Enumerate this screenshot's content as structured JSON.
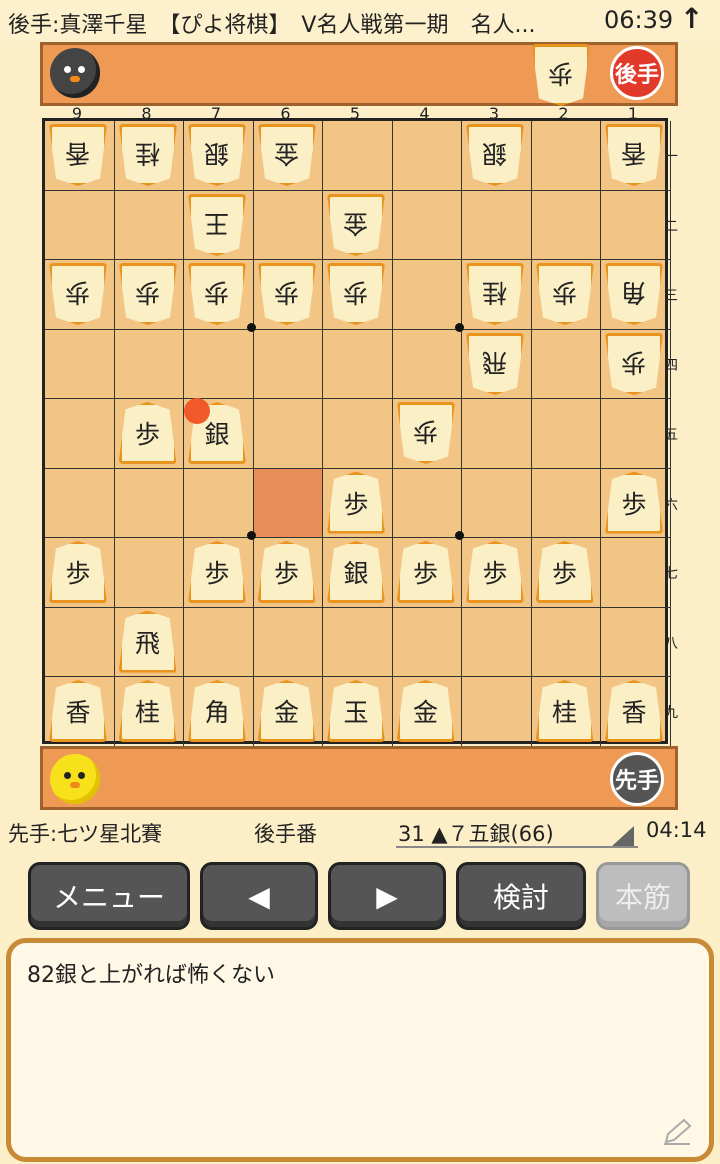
{
  "header": {
    "title": "後手:真澤千星　【ぴよ将棋】　V名人戦第一期　名人...",
    "clock": "06:39",
    "arrow_icon": "up-arrow-icon"
  },
  "gote": {
    "badge": "後手",
    "hand_pieces": [
      {
        "kanji": "歩",
        "count": 1
      }
    ]
  },
  "sente": {
    "badge": "先手",
    "hand_pieces": []
  },
  "board": {
    "files": [
      "9",
      "8",
      "7",
      "6",
      "5",
      "4",
      "3",
      "2",
      "1"
    ],
    "ranks": [
      "一",
      "二",
      "三",
      "四",
      "五",
      "六",
      "七",
      "八",
      "九"
    ],
    "last_move_square": [
      7,
      5
    ],
    "highlight_square": [
      6,
      6
    ],
    "pieces": [
      {
        "f": 9,
        "r": 1,
        "k": "香",
        "side": "gote"
      },
      {
        "f": 8,
        "r": 1,
        "k": "桂",
        "side": "gote"
      },
      {
        "f": 7,
        "r": 1,
        "k": "銀",
        "side": "gote"
      },
      {
        "f": 6,
        "r": 1,
        "k": "金",
        "side": "gote"
      },
      {
        "f": 3,
        "r": 1,
        "k": "銀",
        "side": "gote"
      },
      {
        "f": 1,
        "r": 1,
        "k": "香",
        "side": "gote"
      },
      {
        "f": 7,
        "r": 2,
        "k": "王",
        "side": "gote"
      },
      {
        "f": 5,
        "r": 2,
        "k": "金",
        "side": "gote"
      },
      {
        "f": 9,
        "r": 3,
        "k": "歩",
        "side": "gote"
      },
      {
        "f": 8,
        "r": 3,
        "k": "歩",
        "side": "gote"
      },
      {
        "f": 7,
        "r": 3,
        "k": "歩",
        "side": "gote"
      },
      {
        "f": 6,
        "r": 3,
        "k": "歩",
        "side": "gote"
      },
      {
        "f": 5,
        "r": 3,
        "k": "歩",
        "side": "gote"
      },
      {
        "f": 3,
        "r": 3,
        "k": "桂",
        "side": "gote"
      },
      {
        "f": 2,
        "r": 3,
        "k": "歩",
        "side": "gote"
      },
      {
        "f": 1,
        "r": 3,
        "k": "角",
        "side": "gote"
      },
      {
        "f": 3,
        "r": 4,
        "k": "飛",
        "side": "gote"
      },
      {
        "f": 1,
        "r": 4,
        "k": "歩",
        "side": "gote"
      },
      {
        "f": 8,
        "r": 5,
        "k": "歩",
        "side": "sente"
      },
      {
        "f": 7,
        "r": 5,
        "k": "銀",
        "side": "sente"
      },
      {
        "f": 4,
        "r": 5,
        "k": "歩",
        "side": "gote"
      },
      {
        "f": 5,
        "r": 6,
        "k": "歩",
        "side": "sente"
      },
      {
        "f": 1,
        "r": 6,
        "k": "歩",
        "side": "sente"
      },
      {
        "f": 9,
        "r": 7,
        "k": "歩",
        "side": "sente"
      },
      {
        "f": 7,
        "r": 7,
        "k": "歩",
        "side": "sente"
      },
      {
        "f": 6,
        "r": 7,
        "k": "歩",
        "side": "sente"
      },
      {
        "f": 5,
        "r": 7,
        "k": "銀",
        "side": "sente"
      },
      {
        "f": 4,
        "r": 7,
        "k": "歩",
        "side": "sente"
      },
      {
        "f": 3,
        "r": 7,
        "k": "歩",
        "side": "sente"
      },
      {
        "f": 2,
        "r": 7,
        "k": "歩",
        "side": "sente"
      },
      {
        "f": 8,
        "r": 8,
        "k": "飛",
        "side": "sente"
      },
      {
        "f": 9,
        "r": 9,
        "k": "香",
        "side": "sente"
      },
      {
        "f": 8,
        "r": 9,
        "k": "桂",
        "side": "sente"
      },
      {
        "f": 7,
        "r": 9,
        "k": "角",
        "side": "sente"
      },
      {
        "f": 6,
        "r": 9,
        "k": "金",
        "side": "sente"
      },
      {
        "f": 5,
        "r": 9,
        "k": "玉",
        "side": "sente"
      },
      {
        "f": 4,
        "r": 9,
        "k": "金",
        "side": "sente"
      },
      {
        "f": 2,
        "r": 9,
        "k": "桂",
        "side": "sente"
      },
      {
        "f": 1,
        "r": 9,
        "k": "香",
        "side": "sente"
      }
    ]
  },
  "status": {
    "sente_player": "先手:七ツ星北賽",
    "turn": "後手番",
    "move": "31 ▲７五銀(66)",
    "clock": "04:14"
  },
  "buttons": {
    "menu": "メニュー",
    "prev": "◀",
    "next": "▶",
    "analyze": "検討",
    "mainline": "本筋"
  },
  "comment": {
    "text": "82銀と上がれば怖くない",
    "edit_icon": "pencil-icon"
  }
}
